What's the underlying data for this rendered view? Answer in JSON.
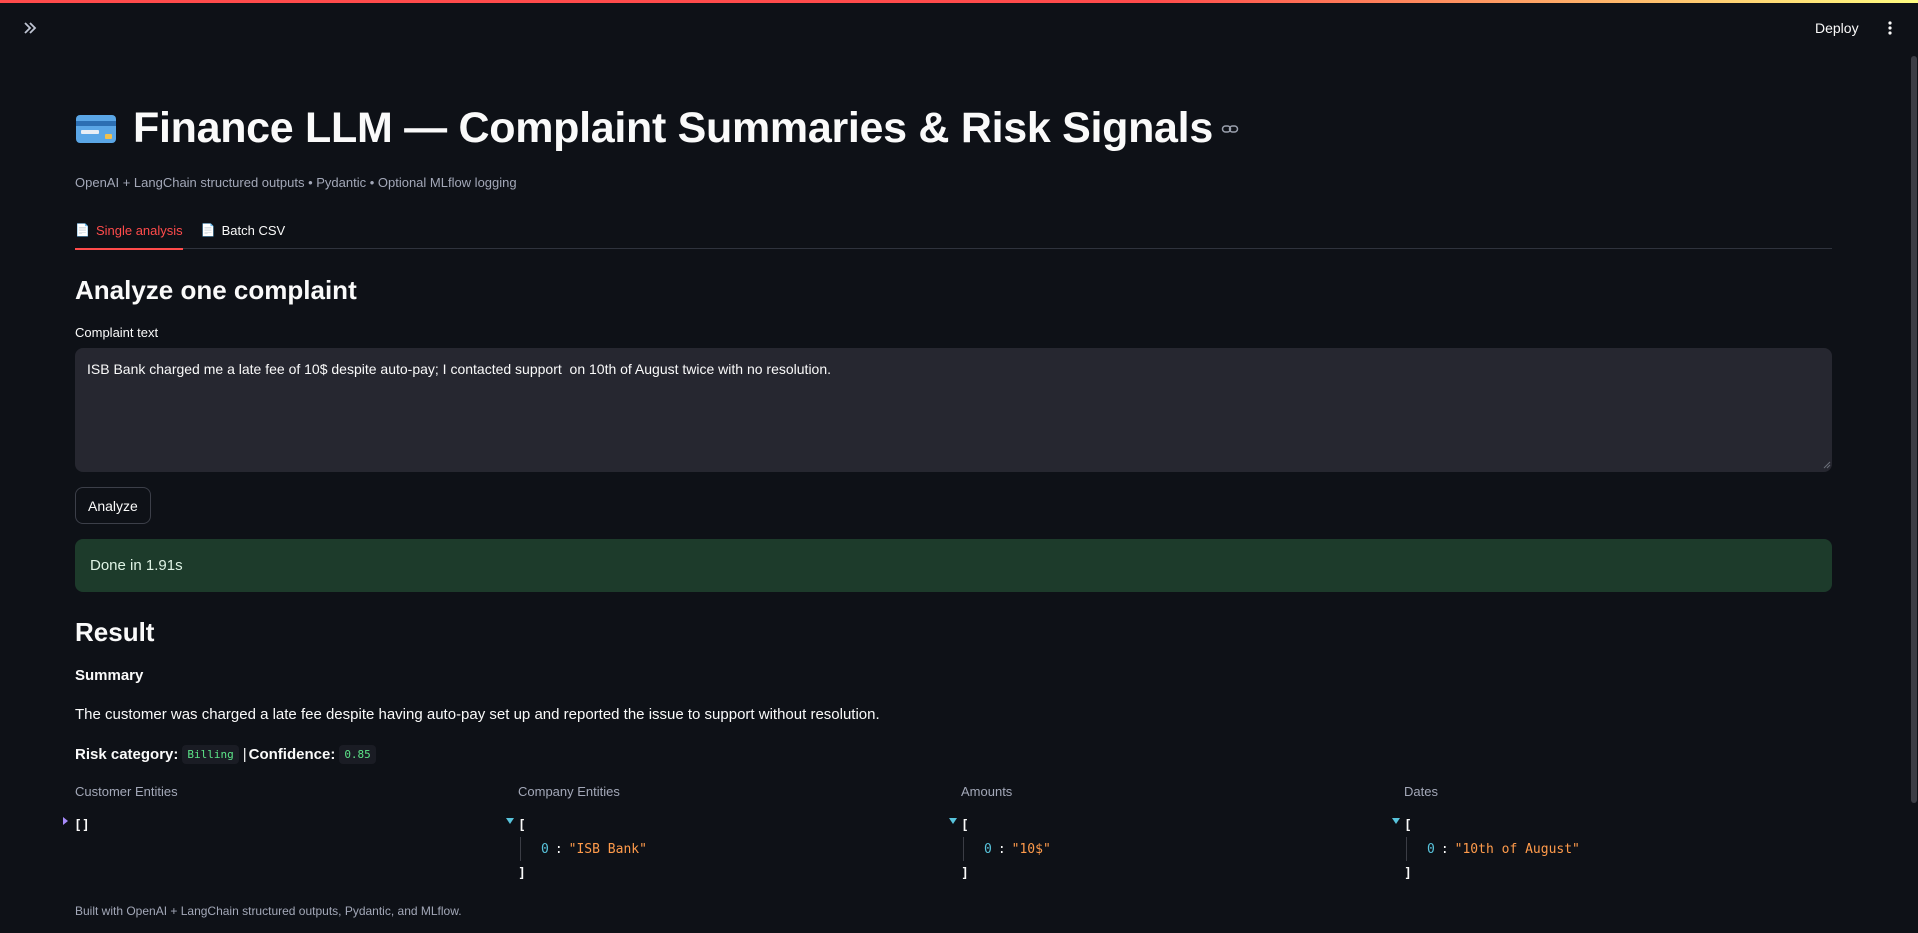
{
  "header": {
    "deploy_label": "Deploy"
  },
  "page": {
    "title": "Finance LLM — Complaint Summaries & Risk Signals",
    "caption": "OpenAI + LangChain structured outputs • Pydantic • Optional MLflow logging",
    "title_icon": "credit-card-icon"
  },
  "tabs": [
    {
      "label": "Single analysis",
      "active": true,
      "icon": "document-icon"
    },
    {
      "label": "Batch CSV",
      "active": false,
      "icon": "document-icon"
    }
  ],
  "analyze": {
    "heading": "Analyze one complaint",
    "field_label": "Complaint text",
    "field_value": "ISB Bank charged me a late fee of 10$ despite auto-pay; I contacted support  on 10th of August twice with no resolution.",
    "button_label": "Analyze",
    "status": "Done in 1.91s"
  },
  "result": {
    "heading": "Result",
    "summary_label": "Summary",
    "summary_text": "The customer was charged a late fee despite having auto-pay set up and reported the issue to support without resolution.",
    "risk_label": "Risk category:",
    "risk_value": "Billing",
    "separator": "|",
    "confidence_label": "Confidence:",
    "confidence_value": "0.85",
    "columns": [
      {
        "label": "Customer Entities",
        "collapsed": true,
        "empty_text": "[]",
        "items": []
      },
      {
        "label": "Company Entities",
        "collapsed": false,
        "items": [
          "\"ISB Bank\""
        ]
      },
      {
        "label": "Amounts",
        "collapsed": false,
        "items": [
          "\"10$\""
        ]
      },
      {
        "label": "Dates",
        "collapsed": false,
        "items": [
          "\"10th of August\""
        ]
      }
    ],
    "json_open": "[",
    "json_close": "]",
    "json_index": "0",
    "json_colon": ":"
  },
  "footer": {
    "text": "Built with OpenAI + LangChain structured outputs, Pydantic, and MLflow."
  },
  "colors": {
    "accent": "#ff4b4b",
    "background": "#0e1117",
    "success_bg": "#1d3b2b",
    "code_green": "#5ce488",
    "json_string": "#ff9b4b"
  }
}
